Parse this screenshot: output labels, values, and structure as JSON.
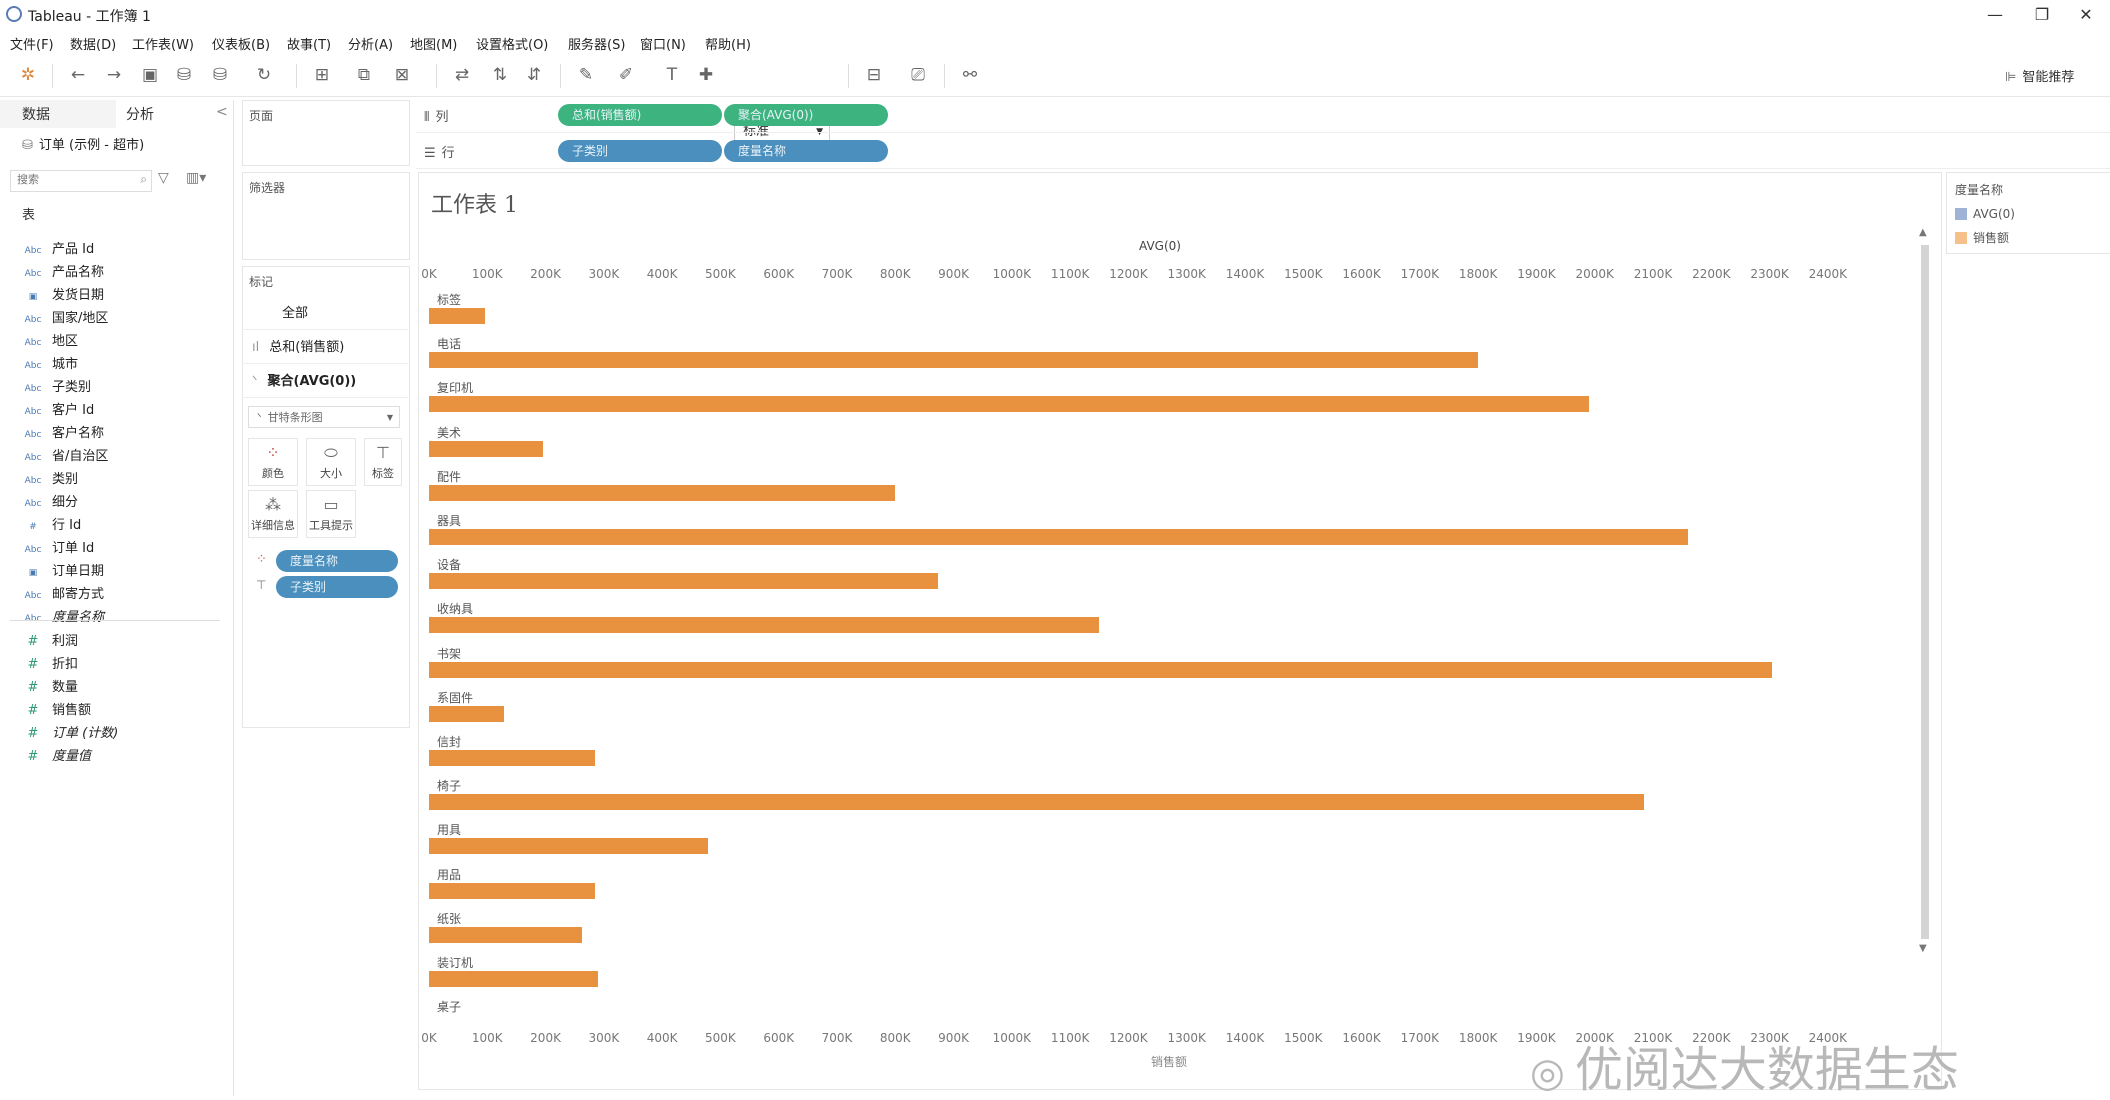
{
  "window": {
    "title": "Tableau - 工作簿 1",
    "min": "—",
    "restore": "❐",
    "close": "✕"
  },
  "menu": [
    "文件(F)",
    "数据(D)",
    "工作表(W)",
    "仪表板(B)",
    "故事(T)",
    "分析(A)",
    "地图(M)",
    "设置格式(O)",
    "服务器(S)",
    "窗口(N)",
    "帮助(H)"
  ],
  "toolbar": {
    "fit": "标准",
    "smart": "智能推荐"
  },
  "data_pane": {
    "tab_data": "数据",
    "tab_analysis": "分析",
    "collapse": "<",
    "datasource": "订单 (示例 - 超市)",
    "search_placeholder": "搜索",
    "section_tables": "表",
    "dimensions": [
      {
        "type": "Abc",
        "name": "产品 Id"
      },
      {
        "type": "Abc",
        "name": "产品名称"
      },
      {
        "type": "date",
        "name": "发货日期"
      },
      {
        "type": "Abc",
        "name": "国家/地区"
      },
      {
        "type": "Abc",
        "name": "地区"
      },
      {
        "type": "Abc",
        "name": "城市"
      },
      {
        "type": "Abc",
        "name": "子类别"
      },
      {
        "type": "Abc",
        "name": "客户 Id"
      },
      {
        "type": "Abc",
        "name": "客户名称"
      },
      {
        "type": "Abc",
        "name": "省/自治区"
      },
      {
        "type": "Abc",
        "name": "类别"
      },
      {
        "type": "Abc",
        "name": "细分"
      },
      {
        "type": "#",
        "name": "行 Id"
      },
      {
        "type": "Abc",
        "name": "订单 Id"
      },
      {
        "type": "date",
        "name": "订单日期"
      },
      {
        "type": "Abc",
        "name": "邮寄方式"
      },
      {
        "type": "Abc",
        "name": "度量名称"
      }
    ],
    "measures": [
      "利润",
      "折扣",
      "数量",
      "销售额",
      "订单 (计数)",
      "度量值"
    ]
  },
  "cards": {
    "pages": "页面",
    "filters": "筛选器",
    "marks": "标记",
    "marks_all": "全部",
    "marks_sum": "总和(销售额)",
    "marks_avg": "聚合(AVG(0))",
    "mark_type": "甘特条形图",
    "btn_color": "颜色",
    "btn_size": "大小",
    "btn_label": "标签",
    "btn_detail": "详细信息",
    "btn_tooltip": "工具提示",
    "pill_color": "度量名称",
    "pill_label": "子类别"
  },
  "shelves": {
    "cols_label": "列",
    "rows_label": "行",
    "cols": [
      "总和(销售额)",
      "聚合(AVG(0))"
    ],
    "rows": [
      "子类别",
      "度量名称"
    ]
  },
  "view": {
    "sheet_title": "工作表 1"
  },
  "legend": {
    "title": "度量名称",
    "items": [
      {
        "name": "AVG(0)",
        "color": "#9fb3d6"
      },
      {
        "name": "销售额",
        "color": "#f6c08a"
      }
    ]
  },
  "watermark": "优阅达大数据生态",
  "colors": {
    "bar": "#e8913f",
    "accent_green": "#3db37f",
    "accent_blue": "#4a8fbd"
  },
  "chart_data": {
    "type": "bar",
    "title": "工作表 1",
    "top_axis_label": "AVG(0)",
    "xlabel": "销售额",
    "xlim": [
      0,
      2450000
    ],
    "tick_labels": [
      "0K",
      "100K",
      "200K",
      "300K",
      "400K",
      "500K",
      "600K",
      "700K",
      "800K",
      "900K",
      "1000K",
      "1100K",
      "1200K",
      "1300K",
      "1400K",
      "1500K",
      "1600K",
      "1700K",
      "1800K",
      "1900K",
      "2000K",
      "2100K",
      "2200K",
      "2300K",
      "2400K"
    ],
    "categories": [
      "标签",
      "电话",
      "复印机",
      "美术",
      "配件",
      "器具",
      "设备",
      "收纳具",
      "书架",
      "系固件",
      "信封",
      "椅子",
      "用具",
      "用品",
      "纸张",
      "装订机",
      "桌子"
    ],
    "series": [
      {
        "name": "销售额",
        "values": [
          96000,
          1800000,
          1990000,
          195000,
          800000,
          2160000,
          873000,
          1150000,
          2305000,
          128000,
          285000,
          2085000,
          478000,
          285000,
          262000,
          290000,
          0
        ]
      }
    ]
  }
}
